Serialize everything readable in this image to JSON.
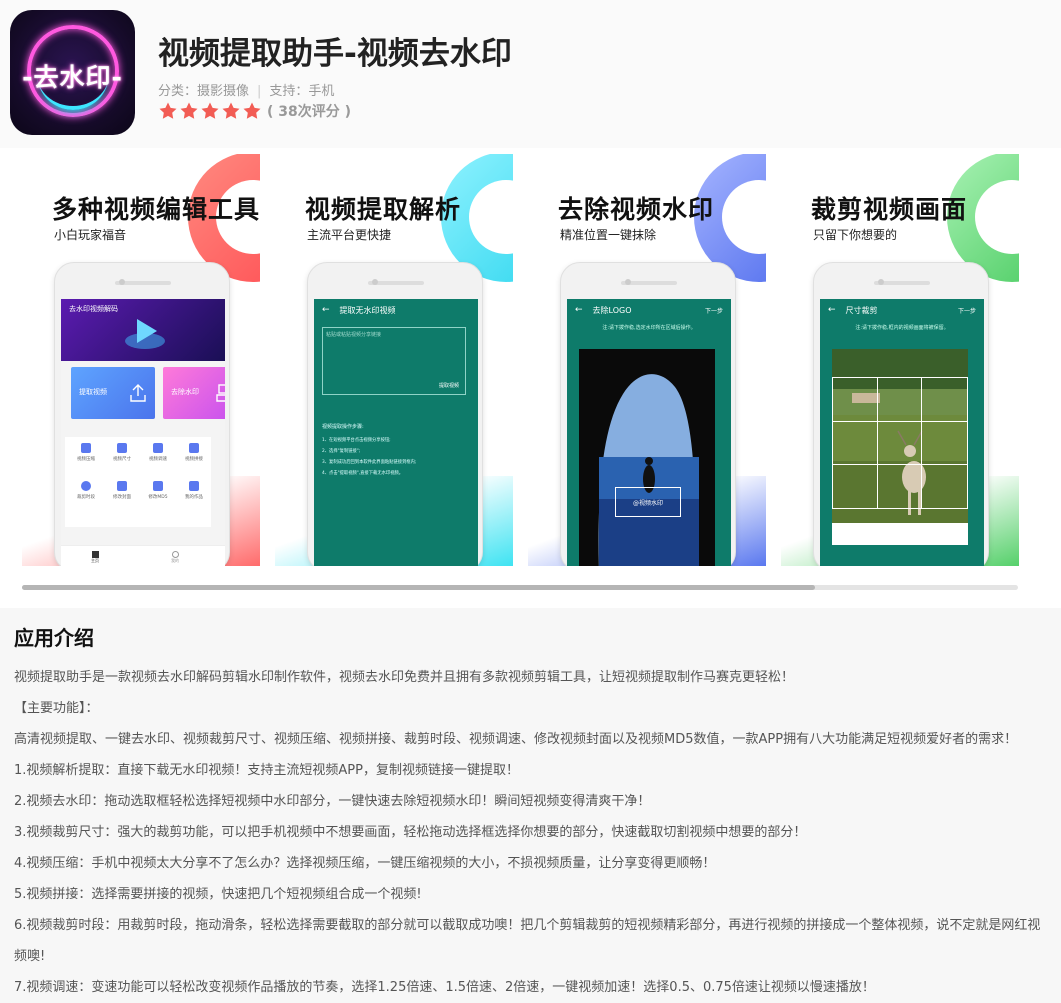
{
  "app": {
    "icon_text": "-去水印-",
    "title": "视频提取助手-视频去水印",
    "category_label": "分类：摄影摄像",
    "support_label": "支持：手机",
    "rating_stars": 5,
    "rating_count": "( 38次评分 )"
  },
  "screenshots": [
    {
      "title": "多种视频编辑工具",
      "subtitle": "小白玩家福音",
      "accent": "#ff5a5f",
      "screen_title": "去水印视频解码",
      "buttons": [
        "提取视频",
        "去除水印"
      ],
      "grid": [
        "视频压缩",
        "视频尺寸",
        "视频调速",
        "视频拼接",
        "裁剪时段",
        "修改封面",
        "修改MD5",
        "我的作品"
      ],
      "tabs": [
        "主页",
        "我的"
      ]
    },
    {
      "title": "视频提取解析",
      "subtitle": "主流平台更快捷",
      "accent": "#3ee3f2",
      "screen_title": "提取无水印视频",
      "placeholder": "粘贴或粘贴视频分享链接",
      "action": "提取视频",
      "steps_title": "视频提取操作步骤:",
      "steps": [
        "1、在短视频平台点击视频分享按钮;",
        "2、选择\"复制链接\";",
        "3、复制成功后回到本软件此界面粘贴链接到框内;",
        "4、点击\"提取视频\",直接下载无水印视频。"
      ]
    },
    {
      "title": "去除视频水印",
      "subtitle": "精准位置一键抹除",
      "accent": "#5a78ef",
      "screen_title": "去除LOGO",
      "next": "下一步",
      "hint": "注:请下拨作稳,选定水印所在区域后操作。",
      "watermark": "@视频水印"
    },
    {
      "title": "裁剪视频画面",
      "subtitle": "只留下你想要的",
      "accent": "#55d06a",
      "screen_title": "尺寸裁剪",
      "next": "下一步",
      "hint": "注:请下拨作稳,框内的视频画面将被保留。"
    }
  ],
  "intro": {
    "heading": "应用介绍",
    "paragraphs": [
      "视频提取助手是一款视频去水印解码剪辑水印制作软件，视频去水印免费并且拥有多款视频剪辑工具，让短视频提取制作马赛克更轻松！",
      "【主要功能】：",
      "高清视频提取、一键去水印、视频裁剪尺寸、视频压缩、视频拼接、裁剪时段、视频调速、修改视频封面以及视频MD5数值，一款APP拥有八大功能满足短视频爱好者的需求！",
      "1.视频解析提取：直接下载无水印视频！支持主流短视频APP，复制视频链接一键提取！",
      "2.视频去水印：拖动选取框轻松选择短视频中水印部分，一键快速去除短视频水印！瞬间短视频变得清爽干净！",
      "3.视频裁剪尺寸：强大的裁剪功能，可以把手机视频中不想要画面，轻松拖动选择框选择你想要的部分，快速截取切割视频中想要的部分！",
      "4.视频压缩：手机中视频太大分享不了怎么办？选择视频压缩，一键压缩视频的大小，不损视频质量，让分享变得更顺畅！",
      "5.视频拼接：选择需要拼接的视频，快速把几个短视频组合成一个视频!",
      "6.视频裁剪时段：用裁剪时段，拖动滑条，轻松选择需要截取的部分就可以截取成功噢！把几个剪辑裁剪的短视频精彩部分，再进行视频的拼接成一个整体视频，说不定就是网红视频噢!",
      "7.视频调速：变速功能可以轻松改变视频作品播放的节奏，选择1.25倍速、1.5倍速、2倍速，一键视频加速！选择0.5、0.75倍速让视频以慢速播放！"
    ]
  }
}
